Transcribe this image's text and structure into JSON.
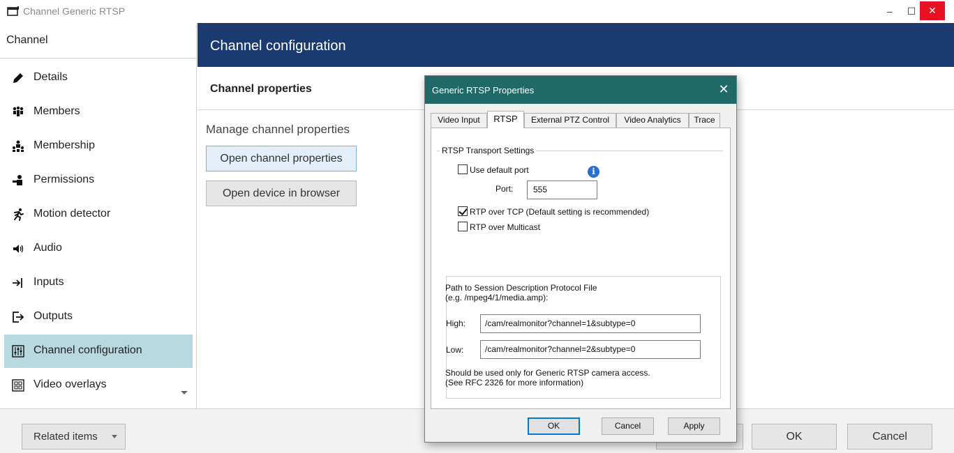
{
  "window": {
    "title": "Channel Generic RTSP",
    "min_glyph": "–",
    "max_glyph": "☐",
    "close_glyph": "✕"
  },
  "sidebar": {
    "header": "Channel",
    "items": [
      {
        "label": "Details",
        "icon": "pencil-icon"
      },
      {
        "label": "Members",
        "icon": "members-icon"
      },
      {
        "label": "Membership",
        "icon": "membership-icon"
      },
      {
        "label": "Permissions",
        "icon": "permissions-icon"
      },
      {
        "label": "Motion detector",
        "icon": "running-man-icon"
      },
      {
        "label": "Audio",
        "icon": "speaker-icon"
      },
      {
        "label": "Inputs",
        "icon": "input-arrow-icon"
      },
      {
        "label": "Outputs",
        "icon": "output-arrow-icon"
      },
      {
        "label": "Channel configuration",
        "icon": "sliders-icon",
        "active": true
      },
      {
        "label": "Video overlays",
        "icon": "grid-icon"
      }
    ]
  },
  "main": {
    "header": "Channel configuration",
    "section_title": "Channel properties",
    "manage_text": "Manage channel properties",
    "open_props_label": "Open channel properties",
    "open_device_label": "Open device in browser"
  },
  "bottom": {
    "related_label": "Related items",
    "ok_label": "OK",
    "cancel_label": "Cancel"
  },
  "dialog": {
    "title": "Generic RTSP Properties",
    "close_glyph": "✕",
    "tabs": [
      "Video Input",
      "RTSP",
      "External PTZ Control",
      "Video Analytics",
      "Trace"
    ],
    "selected_tab": "RTSP",
    "group_title": "RTSP Transport Settings",
    "use_default_port_label": "Use default port",
    "use_default_port_checked": false,
    "info_glyph": "i",
    "port_label": "Port:",
    "port_value": "555",
    "rtp_tcp_label": "RTP over TCP (Default setting is recommended)",
    "rtp_tcp_checked": true,
    "rtp_multicast_label": "RTP over Multicast",
    "rtp_multicast_checked": false,
    "sdp_desc_line1": "Path to Session Description Protocol File",
    "sdp_desc_line2": "(e.g. /mpeg4/1/media.amp):",
    "high_label": "High:",
    "high_value": "/cam/realmonitor?channel=1&subtype=0",
    "low_label": "Low:",
    "low_value": "/cam/realmonitor?channel=2&subtype=0",
    "note_line1": "Should be used only for Generic RTSP camera access.",
    "note_line2": "(See RFC 2326 for more information)",
    "ok_label": "OK",
    "cancel_label": "Cancel",
    "apply_label": "Apply"
  },
  "colors": {
    "header_bg": "#1b3b70",
    "dialog_title_bg": "#1f6a68",
    "active_item_bg": "#b9d9e0",
    "close_btn_bg": "#e81123"
  }
}
